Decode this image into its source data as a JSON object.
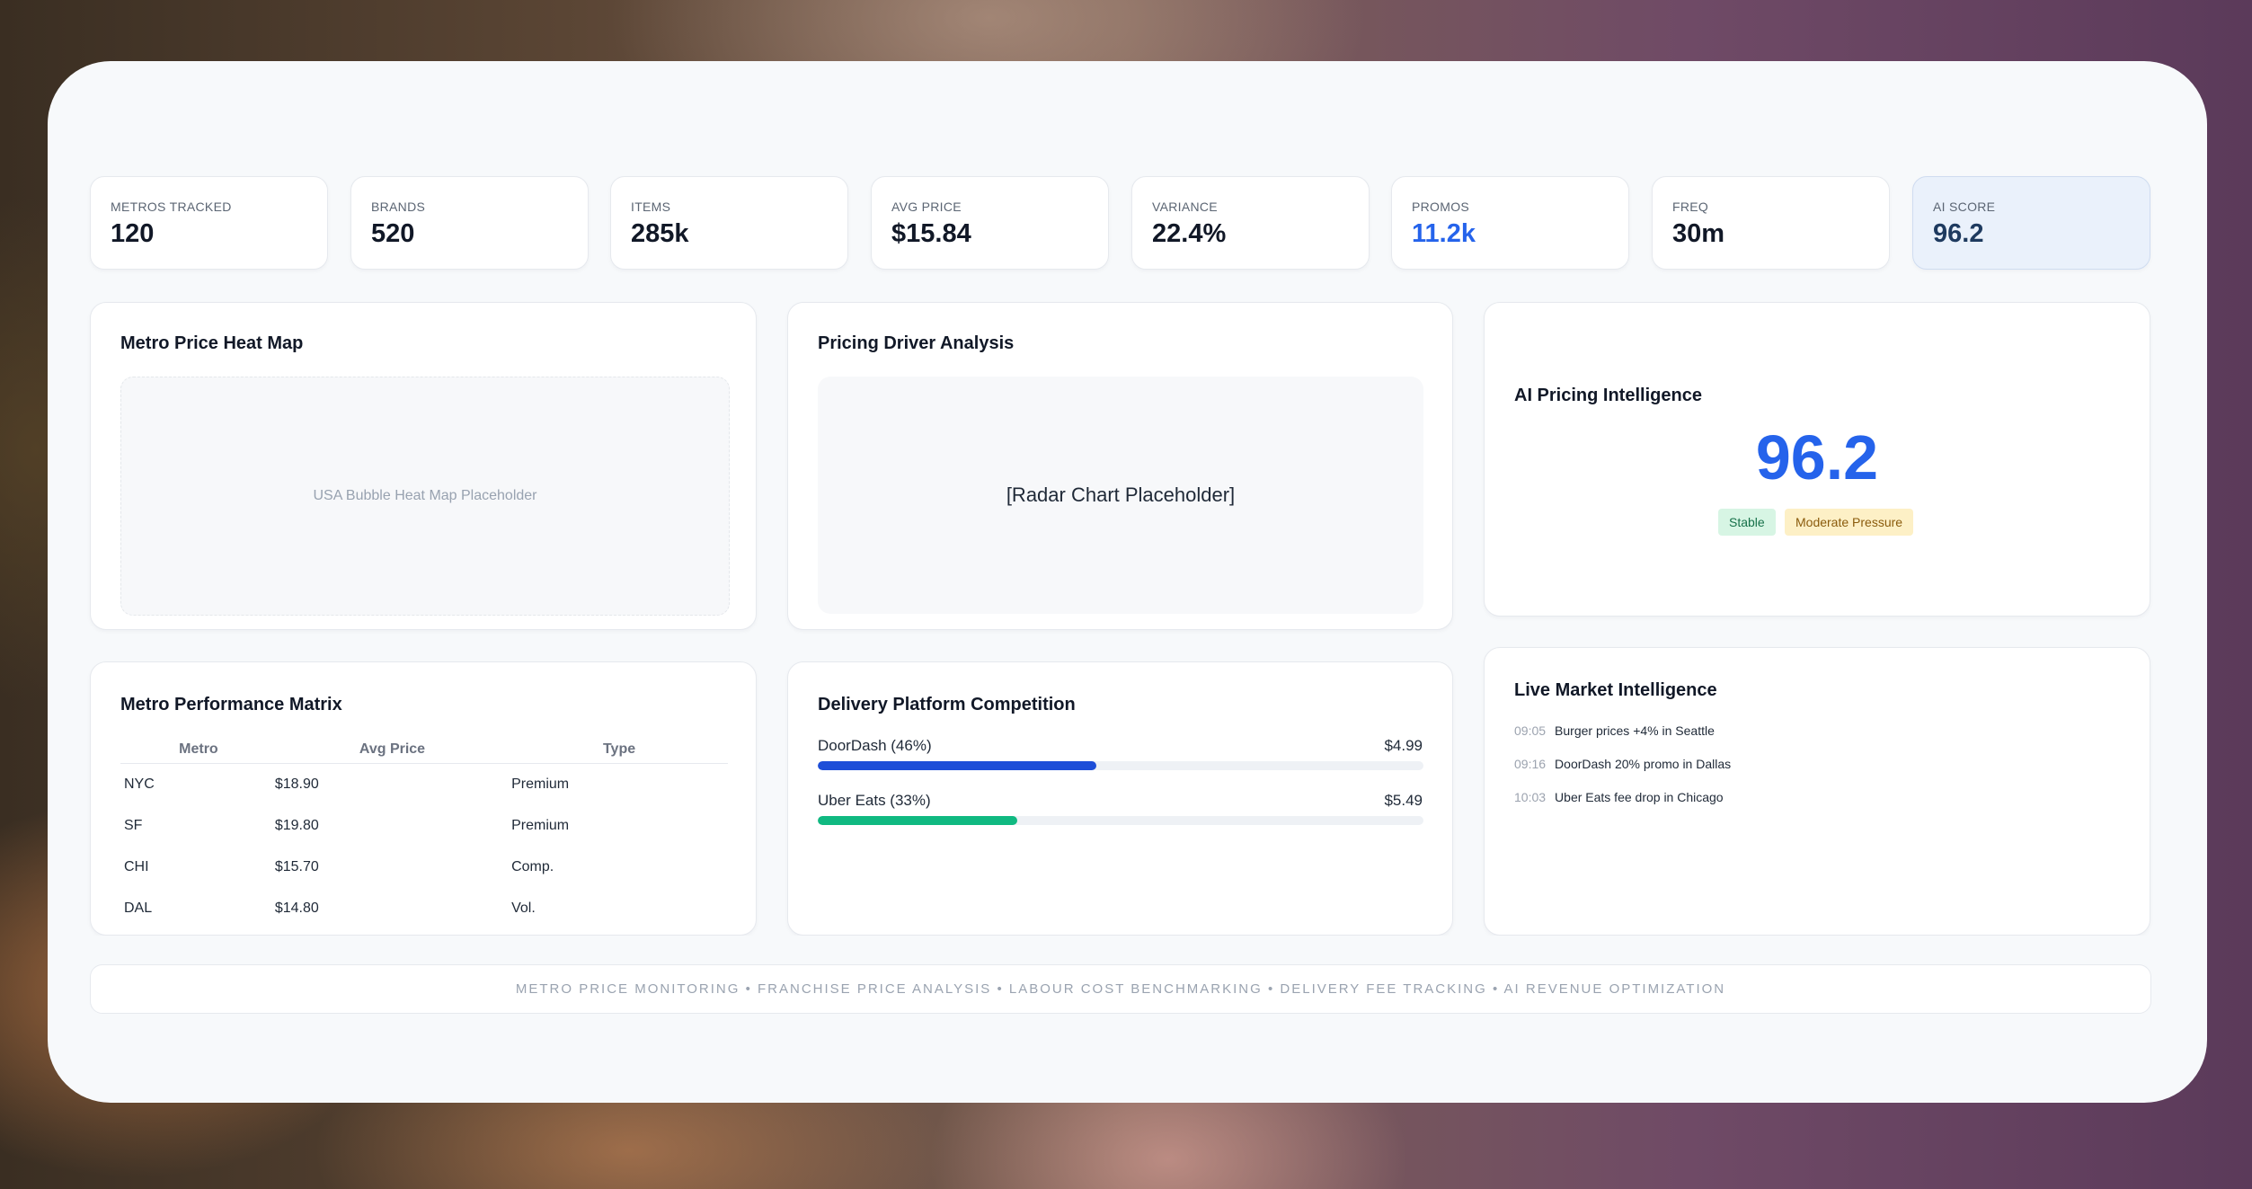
{
  "kpis": [
    {
      "label": "Metros Tracked",
      "value": "120"
    },
    {
      "label": "Brands",
      "value": "520"
    },
    {
      "label": "Items",
      "value": "285k"
    },
    {
      "label": "Avg Price",
      "value": "$15.84"
    },
    {
      "label": "Variance",
      "value": "22.4%"
    },
    {
      "label": "Promos",
      "value": "11.2k"
    },
    {
      "label": "Freq",
      "value": "30m"
    },
    {
      "label": "AI Score",
      "value": "96.2"
    }
  ],
  "heatmap": {
    "title": "Metro Price Heat Map",
    "placeholder": "USA Bubble Heat Map Placeholder"
  },
  "radar": {
    "title": "Pricing Driver Analysis",
    "placeholder": "[Radar Chart Placeholder]"
  },
  "ai": {
    "title": "AI Pricing Intelligence",
    "score": "96.2",
    "tags": [
      "Stable",
      "Moderate Pressure"
    ]
  },
  "matrix": {
    "title": "Metro Performance Matrix",
    "headers": [
      "Metro",
      "Avg Price",
      "Type"
    ],
    "rows": [
      [
        "NYC",
        "$18.90",
        "Premium"
      ],
      [
        "SF",
        "$19.80",
        "Premium"
      ],
      [
        "CHI",
        "$15.70",
        "Comp."
      ],
      [
        "DAL",
        "$14.80",
        "Vol."
      ]
    ]
  },
  "delivery": {
    "title": "Delivery Platform Competition",
    "platforms": [
      {
        "name": "DoorDash (46%)",
        "fee": "$4.99",
        "share": 0.46,
        "color": "#1d4ed8"
      },
      {
        "name": "Uber Eats (33%)",
        "fee": "$5.49",
        "share": 0.33,
        "color": "#10b981"
      }
    ]
  },
  "live": {
    "title": "Live Market Intelligence",
    "items": [
      {
        "time": "09:05",
        "text": "Burger prices +4% in Seattle"
      },
      {
        "time": "09:16",
        "text": "DoorDash 20% promo in Dallas"
      },
      {
        "time": "10:03",
        "text": "Uber Eats fee drop in Chicago"
      }
    ]
  },
  "footer": "METRO PRICE MONITORING • FRANCHISE PRICE ANALYSIS • LABOUR COST BENCHMARKING • DELIVERY FEE TRACKING • AI REVENUE OPTIMIZATION"
}
